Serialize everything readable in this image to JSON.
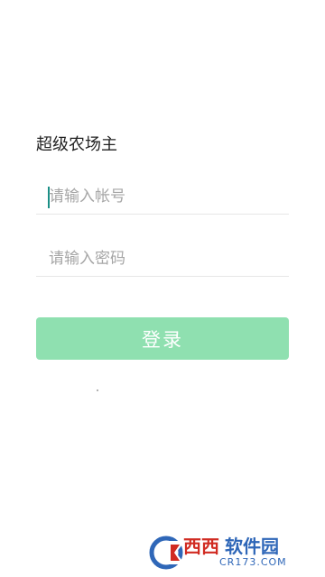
{
  "app": {
    "title": "超级农场主"
  },
  "login_form": {
    "account_placeholder": "请输入帐号",
    "account_value": "",
    "password_placeholder": "请输入密码",
    "password_value": "",
    "login_label": "登录"
  },
  "watermark": {
    "brand": "西西",
    "site": "软件园",
    "url": "CR173.COM"
  },
  "colors": {
    "button_bg": "#8fe0b0",
    "caret": "#1a8f86",
    "title_text": "#222222",
    "placeholder_text": "#a6a6a6"
  },
  "icons": [
    "cr173-logo-icon"
  ]
}
